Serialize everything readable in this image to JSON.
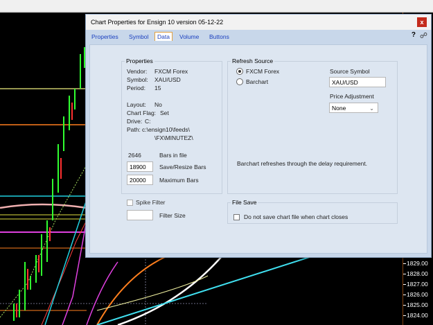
{
  "dialog": {
    "title": "Chart Properties for Ensign 10 version 05-12-22",
    "close_label": "x",
    "help_label": "?"
  },
  "tabs": [
    {
      "label": "Properties"
    },
    {
      "label": "Symbol"
    },
    {
      "label": "Data",
      "active": true
    },
    {
      "label": "Volume"
    },
    {
      "label": "Buttons"
    }
  ],
  "properties": {
    "legend": "Properties",
    "vendor_label": "Vendor:",
    "vendor_value": "FXCM Forex",
    "symbol_label": "Symbol:",
    "symbol_value": "XAU/USD",
    "period_label": "Period:",
    "period_value": "15",
    "layout_label": "Layout:",
    "layout_value": "No",
    "chartflag_label": "Chart Flag:",
    "chartflag_value": "Set",
    "drive_label": "Drive:",
    "drive_value": "C:",
    "path_label": "Path:",
    "path_line1": "c:\\ensign10\\feeds\\",
    "path_line2": "\\FX\\MINUTEZ\\",
    "bars_in_file_value": "2646",
    "bars_in_file_label": "Bars in file",
    "save_resize_value": "18900",
    "save_resize_label": "Save/Resize Bars",
    "maximum_value": "20000",
    "maximum_label": "Maximum Bars",
    "spike_filter_label": "Spike Filter",
    "filter_size_value": "",
    "filter_size_label": "Filter Size"
  },
  "refresh": {
    "legend": "Refresh Source",
    "option1": "FXCM Forex",
    "option2": "Barchart",
    "source_symbol_label": "Source Symbol",
    "source_symbol_value": "XAU/USD",
    "price_adjustment_label": "Price Adjustment",
    "price_adjustment_value": "None",
    "note": "Barchart refreshes through the delay requirement."
  },
  "file_save": {
    "legend": "File Save",
    "checkbox_label": "Do not save chart file when chart closes"
  },
  "axis": {
    "labels": [
      "1829.00",
      "1828.00",
      "1827.00",
      "1826.00",
      "1825.00",
      "1824.00"
    ]
  },
  "colors": {
    "accent_tab": "#e0a040",
    "dialog_bg": "#c8d7ea",
    "panel_bg": "#dde6f1",
    "close_red": "#c42b1c"
  }
}
